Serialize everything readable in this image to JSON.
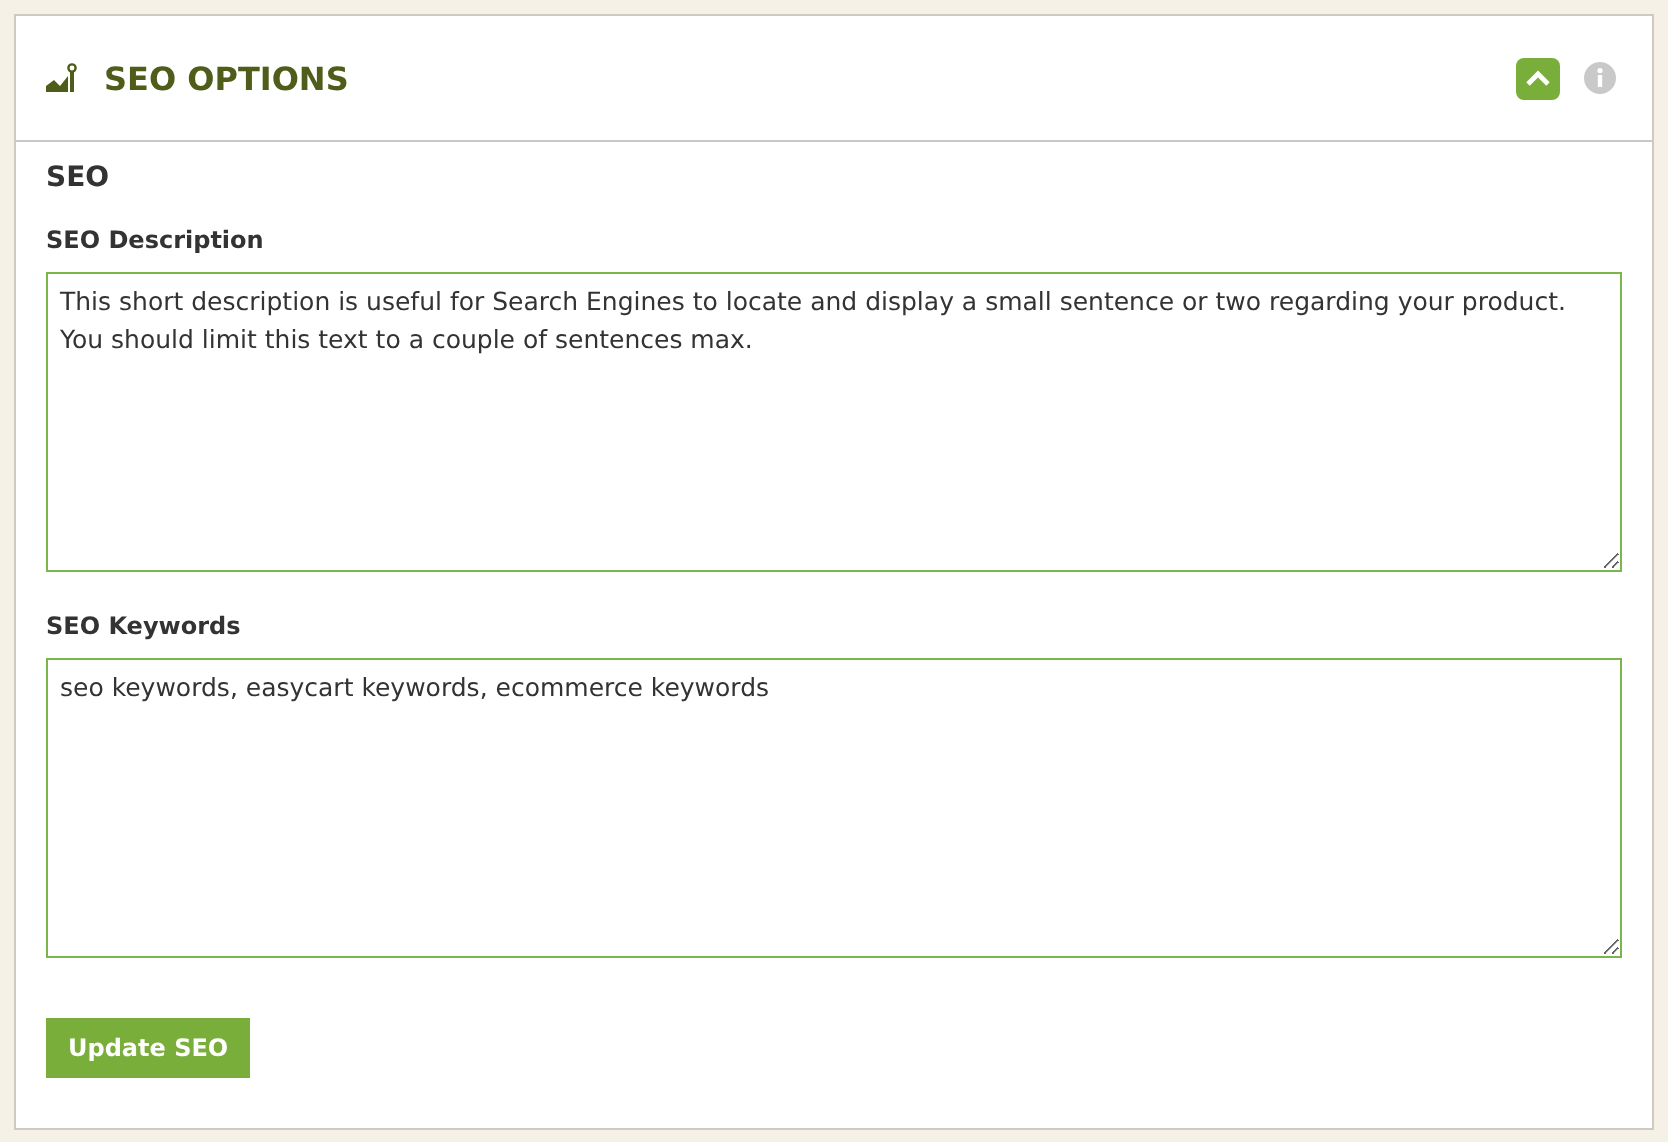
{
  "panel": {
    "title": "SEO OPTIONS",
    "expanded": true
  },
  "section": {
    "heading": "SEO"
  },
  "fields": [
    {
      "label": "SEO Description",
      "value": "This short description is useful for Search Engines to locate and display a small sentence or two regarding your product.  You should limit this text to a couple of sentences max."
    },
    {
      "label": "SEO Keywords",
      "value": "seo keywords, easycart keywords, ecommerce keywords"
    }
  ],
  "button": {
    "label": "Update SEO"
  }
}
